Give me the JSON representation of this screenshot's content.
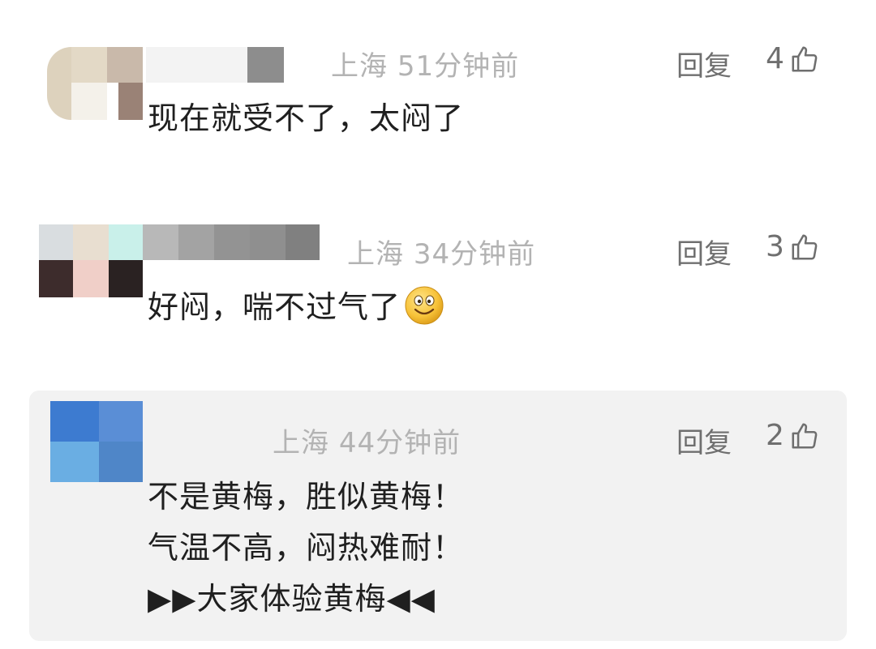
{
  "comments": [
    {
      "location": "上海",
      "time": "51分钟前",
      "reply_label": "回复",
      "likes": "4",
      "lines": [
        "现在就受不了，太闷了"
      ],
      "has_emoji": false,
      "avatar_colors": [
        "#e3d9c6",
        "#c9b9aa",
        "#9a8276"
      ]
    },
    {
      "location": "上海",
      "time": "34分钟前",
      "reply_label": "回复",
      "likes": "3",
      "lines": [
        "好闷，喘不过气了"
      ],
      "has_emoji": true,
      "emoji_icon": "smile-emoji-icon",
      "avatar_colors": [
        "#d9dde0",
        "#e8ded0",
        "#c9f0ea",
        "#3d2c2c",
        "#f0cfc8",
        "#2a2222"
      ]
    },
    {
      "location": "上海",
      "time": "44分钟前",
      "reply_label": "回复",
      "likes": "2",
      "lines": [
        "不是黄梅，胜似黄梅！",
        "气温不高，闷热难耐！",
        "▶▶大家体验黄梅◀◀"
      ],
      "has_emoji": false,
      "avatar_colors": [
        "#3d7bd0",
        "#5a8ed6",
        "#6aaee3",
        "#4f86c8"
      ]
    }
  ],
  "icons": {
    "like": "thumbs-up-icon",
    "emoji": "smile-emoji-icon"
  },
  "colors": {
    "meta_text": "#b3b3b3",
    "action_text": "#6f6f6f",
    "body_text": "#1f1f1f",
    "highlight_bg": "#f2f2f2"
  }
}
